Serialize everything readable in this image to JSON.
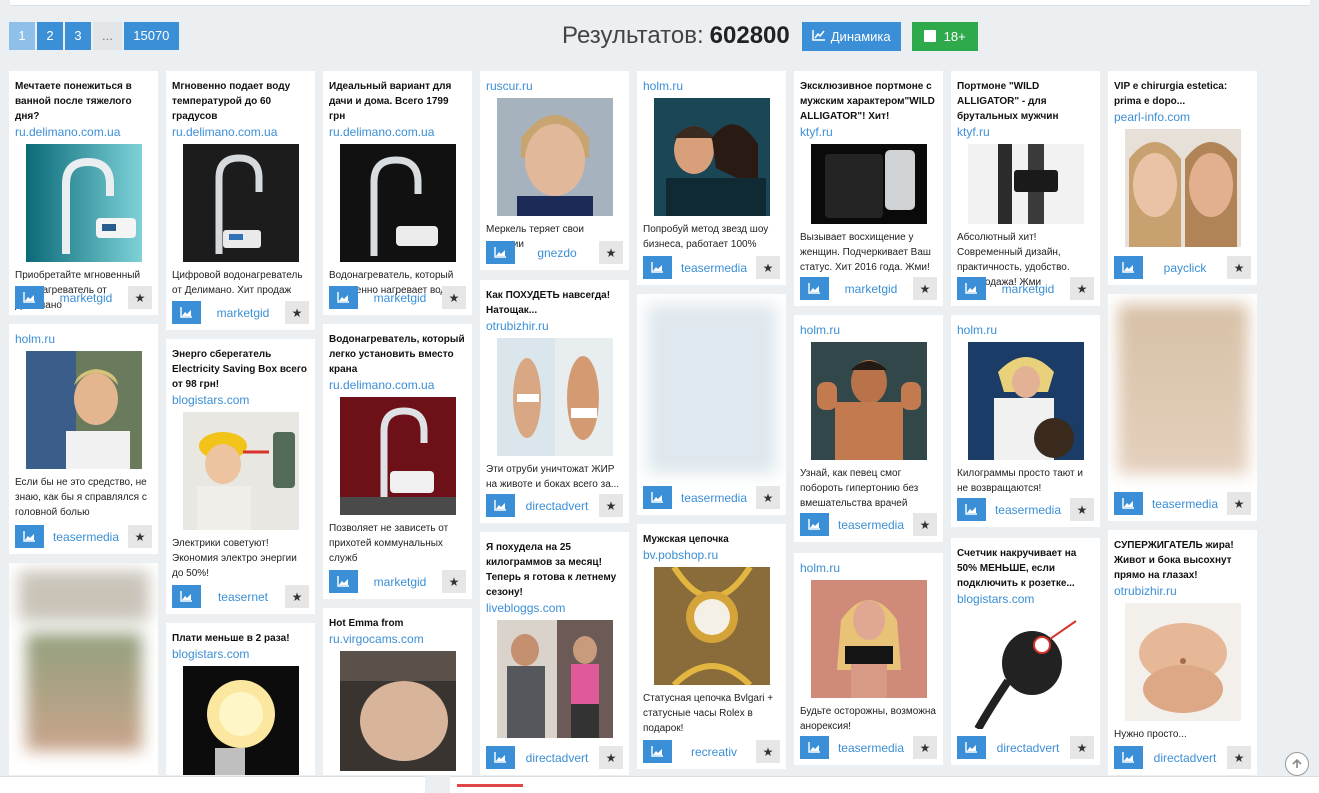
{
  "pagination": {
    "pages": [
      "1",
      "2",
      "3"
    ],
    "ellipsis": "...",
    "last": "15070"
  },
  "results": {
    "label": "Результатов:",
    "count": "602800"
  },
  "buttons": {
    "dynamics": "Динамика",
    "adult": "18+"
  },
  "icons": {
    "dynamics": "chart-line-icon",
    "card_stats": "area-chart-icon",
    "favorite": "star-icon",
    "adult": "checkbox-icon",
    "scroll_up": "arrow-up-circle-icon"
  },
  "colors": {
    "primary": "#3b8fd6",
    "green": "#2eaa4c",
    "accent_red": "#e0454a"
  },
  "cards": [
    {
      "title": "Мечтаете понежиться в ванной после тяжелого дня?",
      "domain": "ru.delimano.com.ua",
      "desc": "Приобретайте мгновенный водонагреватель от Делимано",
      "network": "marketgid"
    },
    {
      "title": "",
      "domain": "holm.ru",
      "desc": "Если бы не это средство, не знаю, как бы я справлялся с головной болью",
      "network": "teasermedia"
    },
    {
      "title": "Мгновенно подает воду температурой до 60 градусов",
      "domain": "ru.delimano.com.ua",
      "desc": "Цифровой водонагреватель от Делимано. Хит продаж",
      "network": "marketgid"
    },
    {
      "title": "Энерго сберегатель Electricity Saving Box всего от 98 грн!",
      "domain": "blogistars.com",
      "desc": "Электрики советуют! Экономия электро энергии до 50%!",
      "network": "teasernet"
    },
    {
      "title": "Плати меньше в 2 раза!",
      "domain": "blogistars.com",
      "desc": "",
      "network": ""
    },
    {
      "title": "Идеальный вариант для дачи и дома. Всего 1799 грн",
      "domain": "ru.delimano.com.ua",
      "desc": "Водонагреватель, который мгновенно нагревает воду",
      "network": "marketgid"
    },
    {
      "title": "Водонагреватель, который легко установить вместо крана",
      "domain": "ru.delimano.com.ua",
      "desc": "Позволяет не зависеть от прихотей коммунальных служб",
      "network": "marketgid"
    },
    {
      "title": "Hot Emma from",
      "domain": "ru.virgocams.com",
      "desc": "",
      "network": ""
    },
    {
      "title": "",
      "domain": "ruscur.ru",
      "desc": "Меркель теряет свои позиции",
      "network": "gnezdo"
    },
    {
      "title": "Как ПОХУДЕТЬ навсегда! Натощак...",
      "domain": "otrubizhir.ru",
      "desc": "Эти отруби уничтожат ЖИР на животе и боках всего за...",
      "network": "directadvert"
    },
    {
      "title": "Я похудела на 25 килограммов за месяц! Теперь я готова к летнему сезону!",
      "domain": "livebloggs.com",
      "desc": "",
      "network": "directadvert"
    },
    {
      "title": "",
      "domain": "holm.ru",
      "desc": "Попробуй метод звезд шоу бизнеса, работает 100%",
      "network": "teasermedia"
    },
    {
      "title": "",
      "domain": "",
      "desc": "",
      "network": "teasermedia"
    },
    {
      "title": "Мужская цепочка",
      "domain": "bv.pobshop.ru",
      "desc": "Статусная цепочка Bvlgari + статусные часы Rolex в подарок!",
      "network": "recreativ"
    },
    {
      "title": "Эксклюзивное портмоне с мужским характером\"WILD ALLIGATOR\"! Хит!",
      "domain": "ktyf.ru",
      "desc": "Вызывает восхищение у женщин. Подчеркивает Ваш статус. Хит 2016 года. Жми!",
      "network": "marketgid"
    },
    {
      "title": "",
      "domain": "holm.ru",
      "desc": "Узнай, как певец смог побороть гипертонию без вмешательства врачей",
      "network": "teasermedia"
    },
    {
      "title": "",
      "domain": "holm.ru",
      "desc": "Будьте осторожны, возможна анорексия!",
      "network": "teasermedia"
    },
    {
      "title": "Портмоне \"WILD ALLIGATOR\" - для брутальных мужчин",
      "domain": "ktyf.ru",
      "desc": "Абсолютный хит! Современный дизайн, практичность, удобство. Распродажа! Жми",
      "network": "marketgid"
    },
    {
      "title": "",
      "domain": "holm.ru",
      "desc": "Килограммы просто тают и не возвращаются!",
      "network": "teasermedia"
    },
    {
      "title": "Счетчик накручивает на 50% МЕНЬШЕ, если подключить к розетке...",
      "domain": "blogistars.com",
      "desc": "",
      "network": "directadvert"
    },
    {
      "title": "VIP e chirurgia estetica: prima e dopo...",
      "domain": "pearl-info.com",
      "desc": "",
      "network": "payclick"
    },
    {
      "title": "",
      "domain": "",
      "desc": "",
      "network": "teasermedia"
    },
    {
      "title": "СУПЕРЖИГАТЕЛЬ жира! Живот и бока высохнут прямо на глазах!",
      "domain": "otrubizhir.ru",
      "desc": "Нужно просто...",
      "network": "directadvert"
    }
  ]
}
